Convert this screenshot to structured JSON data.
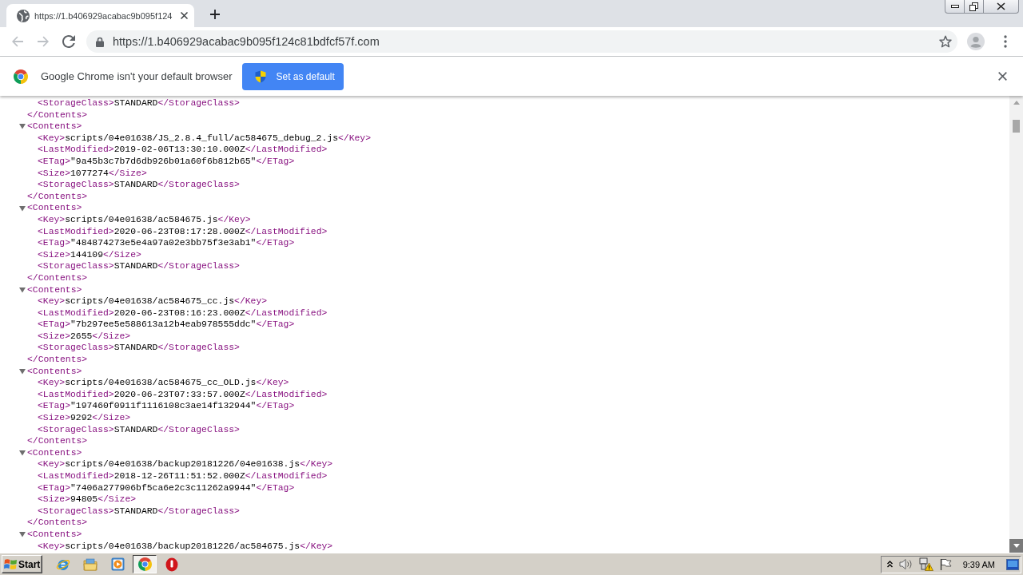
{
  "browser": {
    "tabs": [
      {
        "title": "https://1.b406929acabac9b095f124",
        "selected": true
      }
    ],
    "nav_buttons": [
      {
        "kind": "back",
        "disabled": true
      },
      {
        "kind": "forward",
        "disabled": true
      },
      {
        "kind": "reload",
        "disabled": false
      }
    ],
    "address_bar": {
      "url": "https://1.b406929acabac9b095f124c81bdfcf57f.com"
    }
  },
  "infobar": {
    "message": "Google Chrome isn't your default browser",
    "button": "Set as default"
  },
  "xml_view": {
    "nodes": [
      {
        "children": [
          {
            "open": "<StorageClass>",
            "text": "STANDARD",
            "close": "</StorageClass>"
          }
        ],
        "close": "</Contents>"
      },
      {
        "open": "<Contents>",
        "expanded": true,
        "children": [
          {
            "open": "<Key>",
            "text": "scripts/04e01638/JS_2.8.4_full/ac584675_debug_2.js",
            "close": "</Key>"
          },
          {
            "open": "<LastModified>",
            "text": "2019-02-06T13:30:10.000Z",
            "close": "</LastModified>"
          },
          {
            "open": "<ETag>",
            "text": "\"9a45b3c7b7d6db926b01a60f6b812b65\"",
            "close": "</ETag>"
          },
          {
            "open": "<Size>",
            "text": "1077274",
            "close": "</Size>"
          },
          {
            "open": "<StorageClass>",
            "text": "STANDARD",
            "close": "</StorageClass>"
          }
        ],
        "close": "</Contents>"
      },
      {
        "open": "<Contents>",
        "expanded": true,
        "children": [
          {
            "open": "<Key>",
            "text": "scripts/04e01638/ac584675.js",
            "close": "</Key>"
          },
          {
            "open": "<LastModified>",
            "text": "2020-06-23T08:17:28.000Z",
            "close": "</LastModified>"
          },
          {
            "open": "<ETag>",
            "text": "\"484874273e5e4a97a02e3bb75f3e3ab1\"",
            "close": "</ETag>"
          },
          {
            "open": "<Size>",
            "text": "144109",
            "close": "</Size>"
          },
          {
            "open": "<StorageClass>",
            "text": "STANDARD",
            "close": "</StorageClass>"
          }
        ],
        "close": "</Contents>"
      },
      {
        "open": "<Contents>",
        "expanded": true,
        "children": [
          {
            "open": "<Key>",
            "text": "scripts/04e01638/ac584675_cc.js",
            "close": "</Key>"
          },
          {
            "open": "<LastModified>",
            "text": "2020-06-23T08:16:23.000Z",
            "close": "</LastModified>"
          },
          {
            "open": "<ETag>",
            "text": "\"7b297ee5e588613a12b4eab978555ddc\"",
            "close": "</ETag>"
          },
          {
            "open": "<Size>",
            "text": "2655",
            "close": "</Size>"
          },
          {
            "open": "<StorageClass>",
            "text": "STANDARD",
            "close": "</StorageClass>"
          }
        ],
        "close": "</Contents>"
      },
      {
        "open": "<Contents>",
        "expanded": true,
        "children": [
          {
            "open": "<Key>",
            "text": "scripts/04e01638/ac584675_cc_OLD.js",
            "close": "</Key>"
          },
          {
            "open": "<LastModified>",
            "text": "2020-06-23T07:33:57.000Z",
            "close": "</LastModified>"
          },
          {
            "open": "<ETag>",
            "text": "\"197460f0911f1116108c3ae14f132944\"",
            "close": "</ETag>"
          },
          {
            "open": "<Size>",
            "text": "9292",
            "close": "</Size>"
          },
          {
            "open": "<StorageClass>",
            "text": "STANDARD",
            "close": "</StorageClass>"
          }
        ],
        "close": "</Contents>"
      },
      {
        "open": "<Contents>",
        "expanded": true,
        "children": [
          {
            "open": "<Key>",
            "text": "scripts/04e01638/backup20181226/04e01638.js",
            "close": "</Key>"
          },
          {
            "open": "<LastModified>",
            "text": "2018-12-26T11:51:52.000Z",
            "close": "</LastModified>"
          },
          {
            "open": "<ETag>",
            "text": "\"7406a277906bf5ca6e2c3c11262a9944\"",
            "close": "</ETag>"
          },
          {
            "open": "<Size>",
            "text": "94805",
            "close": "</Size>"
          },
          {
            "open": "<StorageClass>",
            "text": "STANDARD",
            "close": "</StorageClass>"
          }
        ],
        "close": "</Contents>"
      },
      {
        "open": "<Contents>",
        "expanded": true,
        "children": [
          {
            "open": "<Key>",
            "text": "scripts/04e01638/backup20181226/ac584675.js",
            "close": "</Key>"
          }
        ]
      }
    ]
  },
  "taskbar": {
    "start": "Start",
    "apps": [
      {
        "kind": "web",
        "selected": false
      },
      {
        "kind": "folder",
        "selected": false
      },
      {
        "kind": "player",
        "selected": false
      },
      {
        "kind": "browser",
        "selected": true
      },
      {
        "kind": "alert",
        "selected": false
      }
    ],
    "clock": "9:39 AM"
  }
}
